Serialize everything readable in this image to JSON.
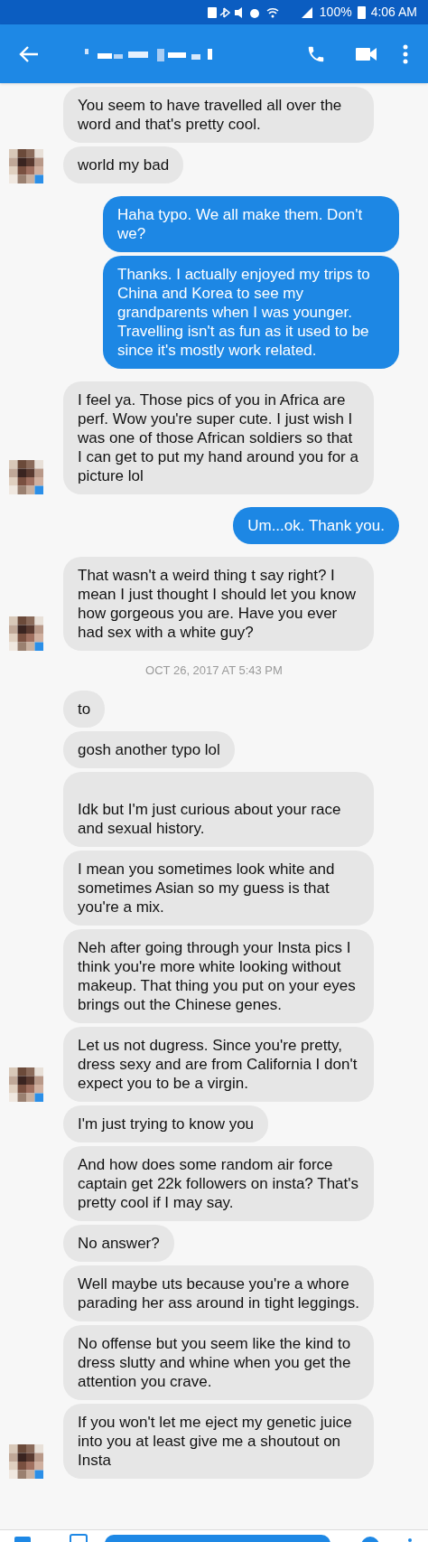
{
  "status_bar": {
    "battery": "100%",
    "time": "4:06 AM"
  },
  "messages": [
    {
      "kind": "received",
      "text": "You seem to have travelled all over the word and that's pretty cool.",
      "avatar": false
    },
    {
      "kind": "received",
      "text": "world my bad",
      "avatar": true
    },
    {
      "kind": "sent",
      "text": "Haha typo. We all make them. Don't we?"
    },
    {
      "kind": "sent",
      "text": "Thanks. I actually enjoyed my trips to China and Korea to see my grandparents when I was younger. Travelling isn't as fun as it used to be since it's mostly work related."
    },
    {
      "kind": "received",
      "text": "I feel ya. Those pics of you in Africa are perf. Wow you're super cute. I just wish I was one of those African soldiers so that I can get to put my hand around you for a picture lol",
      "avatar": true
    },
    {
      "kind": "sent",
      "text": "Um...ok. Thank you."
    },
    {
      "kind": "received",
      "text": "That wasn't a weird thing t say right? I mean I just thought I should let you know how gorgeous you are. Have you ever had sex with a white guy?",
      "avatar": true
    },
    {
      "kind": "timestamp",
      "text": "OCT 26, 2017 AT 5:43 PM"
    },
    {
      "kind": "received",
      "text": "to",
      "avatar": false
    },
    {
      "kind": "received",
      "text": "gosh another typo lol",
      "avatar": false
    },
    {
      "kind": "received",
      "text": "Idk but I'm just curious about your race and sexual history.",
      "avatar": false,
      "leading_blank": true
    },
    {
      "kind": "received",
      "text": "I mean you sometimes look white and sometimes Asian so my guess is that you're a mix.",
      "avatar": false
    },
    {
      "kind": "received",
      "text": "Neh after going through your Insta pics I think you're more white looking without makeup. That thing you put on your eyes brings out the Chinese genes.",
      "avatar": false
    },
    {
      "kind": "received",
      "text": "Let us not dugress. Since you're pretty, dress sexy and are from California I don't expect you to be a virgin.",
      "avatar": true
    },
    {
      "kind": "received",
      "text": "I'm just trying to know you",
      "avatar": false
    },
    {
      "kind": "received",
      "text": "And how does some random air force captain get 22k followers on insta? That's pretty cool if I may say.",
      "avatar": false
    },
    {
      "kind": "received",
      "text": "No answer?",
      "avatar": false
    },
    {
      "kind": "received",
      "text": "Well maybe uts because you're a whore parading her ass around in tight leggings.",
      "avatar": false
    },
    {
      "kind": "received",
      "text": "No offense but you seem like the kind to dress slutty and whine when you get the attention you crave.",
      "avatar": false
    },
    {
      "kind": "received",
      "text": "If you won't let me eject my genetic juice into you at least give me a shoutout on Insta",
      "avatar": true
    }
  ]
}
